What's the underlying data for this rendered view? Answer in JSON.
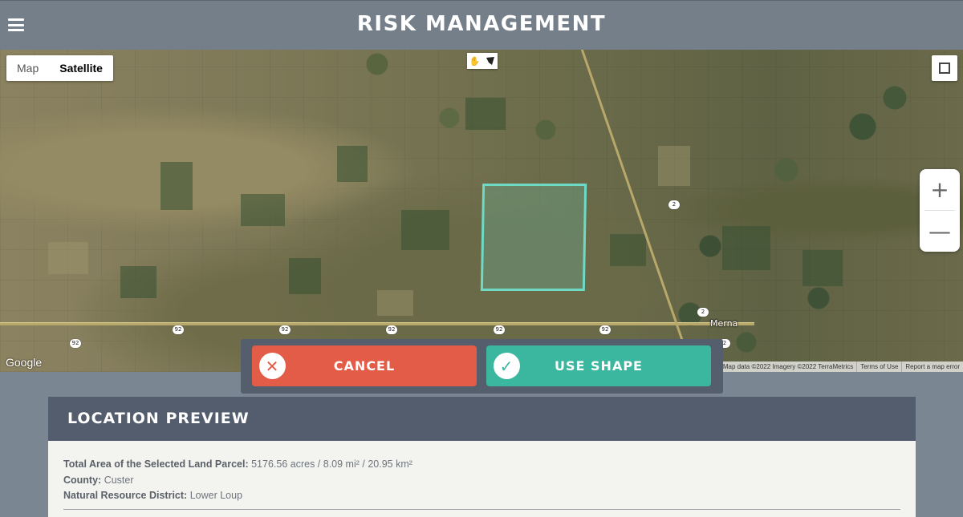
{
  "header": {
    "title": "RISK MANAGEMENT"
  },
  "map": {
    "type_options": [
      "Map",
      "Satellite"
    ],
    "selected_type": "Satellite",
    "town_label": "Merna",
    "route_shields": [
      "92",
      "92",
      "92",
      "92",
      "92",
      "92",
      "2",
      "2",
      "2"
    ],
    "google_label": "Google",
    "attribution": [
      "Map data ©2022 Imagery ©2022 TerraMetrics",
      "Terms of Use",
      "Report a map error"
    ],
    "zoom_in": "+",
    "zoom_out": "—"
  },
  "actions": {
    "cancel_label": "CANCEL",
    "use_shape_label": "USE SHAPE"
  },
  "preview": {
    "title": "LOCATION PREVIEW",
    "area_label": "Total Area of the Selected Land Parcel:",
    "area_value": "5176.56 acres / 8.09 mi² / 20.95 km²",
    "county_label": "County:",
    "county_value": "Custer",
    "district_label": "Natural Resource District:",
    "district_value": "Lower Loup"
  },
  "colors": {
    "header_bg": "#747f8a",
    "cancel": "#e25c48",
    "use_shape": "#3bb7a0",
    "parcel": "#6ed9c4",
    "preview_head": "#535d6e"
  }
}
